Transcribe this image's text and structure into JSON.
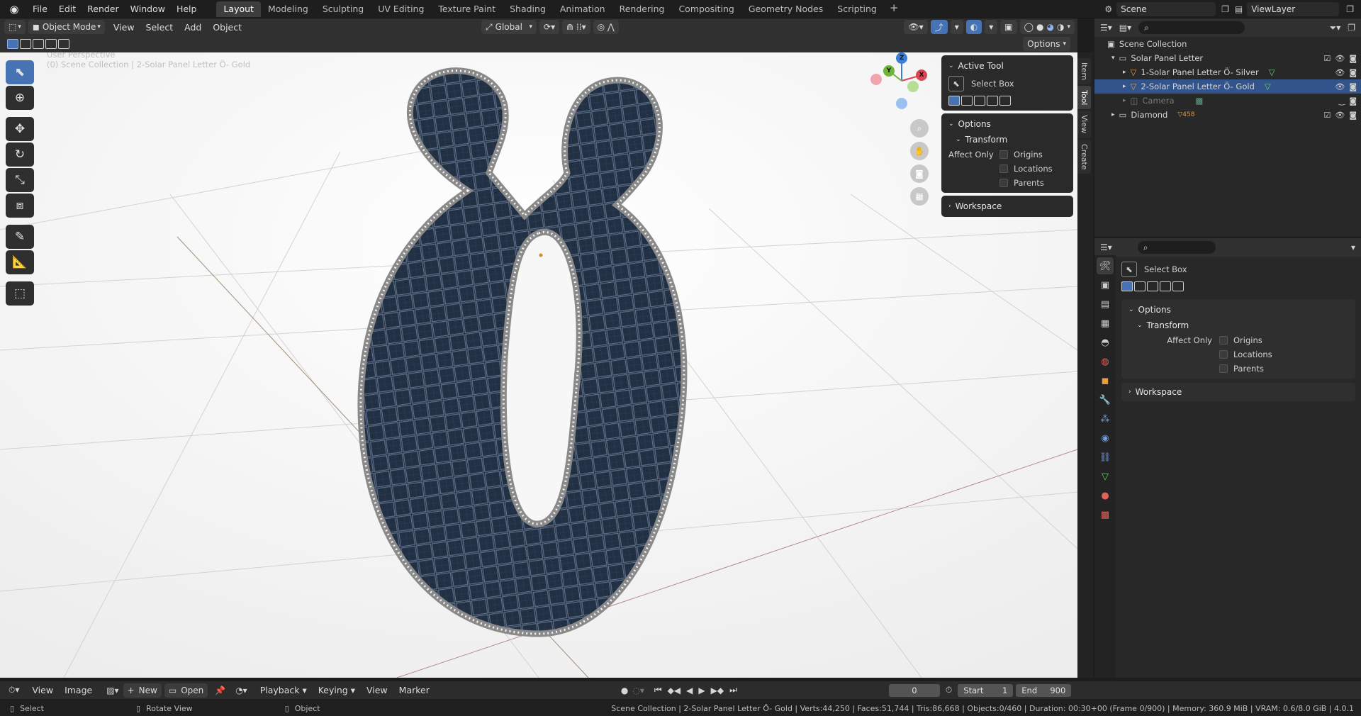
{
  "topbar": {
    "menus": [
      "File",
      "Edit",
      "Render",
      "Window",
      "Help"
    ],
    "workspaces": [
      "Layout",
      "Modeling",
      "Sculpting",
      "UV Editing",
      "Texture Paint",
      "Shading",
      "Animation",
      "Rendering",
      "Compositing",
      "Geometry Nodes",
      "Scripting"
    ],
    "active_workspace": "Layout",
    "scene": "Scene",
    "view_layer": "ViewLayer"
  },
  "viewport_header": {
    "mode": "Object Mode",
    "menus": [
      "View",
      "Select",
      "Add",
      "Object"
    ],
    "orientation": "Global",
    "options_label": "Options"
  },
  "viewport": {
    "perspective": "User Perspective",
    "collection_info": "(0) Scene Collection | 2-Solar Panel Letter Ö- Gold",
    "gizmo": {
      "x": "X",
      "y": "Y",
      "z": "Z"
    }
  },
  "npanel": {
    "active_tool_title": "Active Tool",
    "tool_name": "Select Box",
    "options_title": "Options",
    "transform_title": "Transform",
    "affect_only": "Affect Only",
    "origins": "Origins",
    "locations": "Locations",
    "parents": "Parents",
    "workspace": "Workspace",
    "tabs": [
      "Item",
      "Tool",
      "View",
      "Create"
    ]
  },
  "outliner": {
    "scene_collection": "Scene Collection",
    "items": [
      {
        "name": "Solar Panel Letter",
        "level": 1
      },
      {
        "name": "1-Solar Panel Letter Ö- Silver",
        "level": 2
      },
      {
        "name": "2-Solar Panel Letter Ö- Gold",
        "level": 2,
        "selected": true
      },
      {
        "name": "Camera",
        "level": 2
      },
      {
        "name": "Diamond",
        "level": 1,
        "badge": "458"
      }
    ]
  },
  "properties": {
    "tool_name": "Select Box",
    "options_title": "Options",
    "transform_title": "Transform",
    "affect_only": "Affect Only",
    "origins": "Origins",
    "locations": "Locations",
    "parents": "Parents",
    "workspace": "Workspace"
  },
  "timeline": {
    "menus_left": [
      "View",
      "Image"
    ],
    "new_label": "New",
    "open_label": "Open",
    "playback": "Playback",
    "keying": "Keying",
    "view": "View",
    "marker": "Marker",
    "current_frame": "0",
    "start_label": "Start",
    "start": "1",
    "end_label": "End",
    "end": "900"
  },
  "statusbar": {
    "select": "Select",
    "rotate": "Rotate View",
    "object": "Object",
    "info": "Scene Collection | 2-Solar Panel Letter Ö- Gold | Verts:44,250 | Faces:51,744 | Tris:86,668 | Objects:0/460 | Duration: 00:30+00 (Frame 0/900) | Memory: 360.9 MiB | VRAM: 0.6/8.0 GiB | 4.0.1"
  },
  "colors": {
    "accent": "#4772b3",
    "selected_row": "#33548a",
    "viewport_bg": "#f5f5f5"
  }
}
